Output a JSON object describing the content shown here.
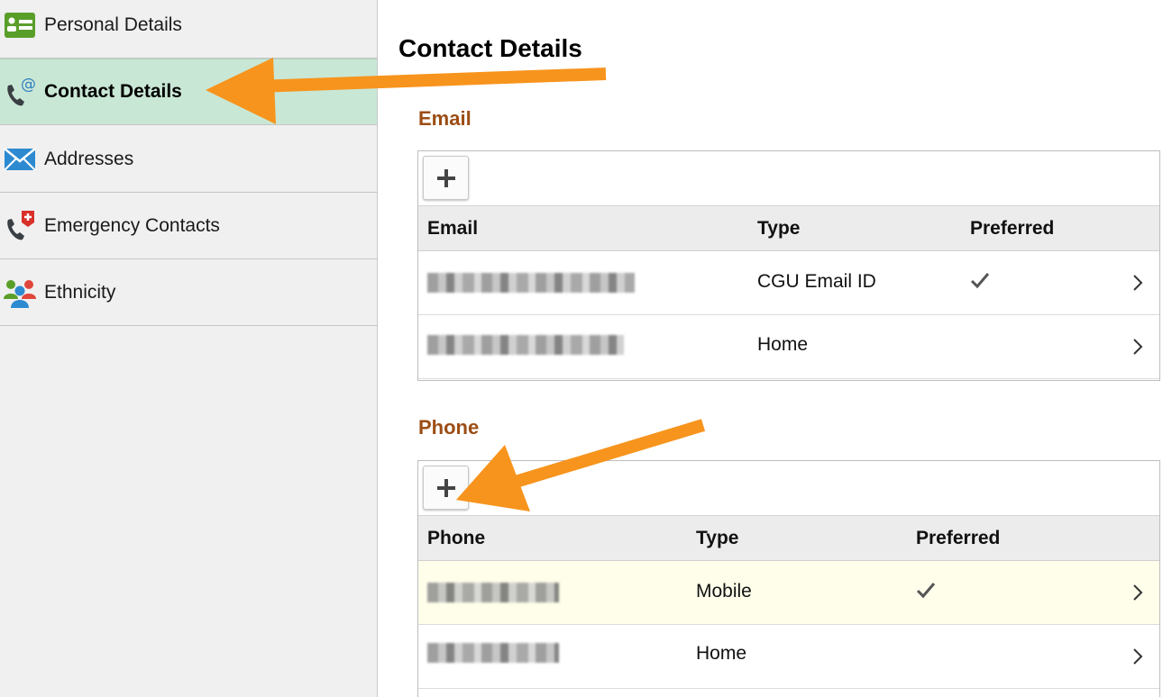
{
  "sidebar": {
    "items": [
      {
        "label": "Personal Details",
        "icon": "id-card-icon",
        "active": false
      },
      {
        "label": "Contact Details",
        "icon": "phone-at-icon",
        "active": true
      },
      {
        "label": "Addresses",
        "icon": "envelope-icon",
        "active": false
      },
      {
        "label": "Emergency Contacts",
        "icon": "emergency-phone-icon",
        "active": false
      },
      {
        "label": "Ethnicity",
        "icon": "people-icon",
        "active": false
      }
    ]
  },
  "main": {
    "title": "Contact Details",
    "email": {
      "section_title": "Email",
      "columns": [
        "Email",
        "Type",
        "Preferred"
      ],
      "rows": [
        {
          "type": "CGU Email ID",
          "preferred": true
        },
        {
          "type": "Home",
          "preferred": false
        }
      ]
    },
    "phone": {
      "section_title": "Phone",
      "columns": [
        "Phone",
        "Type",
        "Preferred"
      ],
      "rows": [
        {
          "type": "Mobile",
          "preferred": true
        },
        {
          "type": "Home",
          "preferred": false
        }
      ]
    }
  },
  "colors": {
    "accent_section": "#9c4d14",
    "active_nav": "#c9e7d5",
    "annotation_arrow": "#f7941d"
  }
}
